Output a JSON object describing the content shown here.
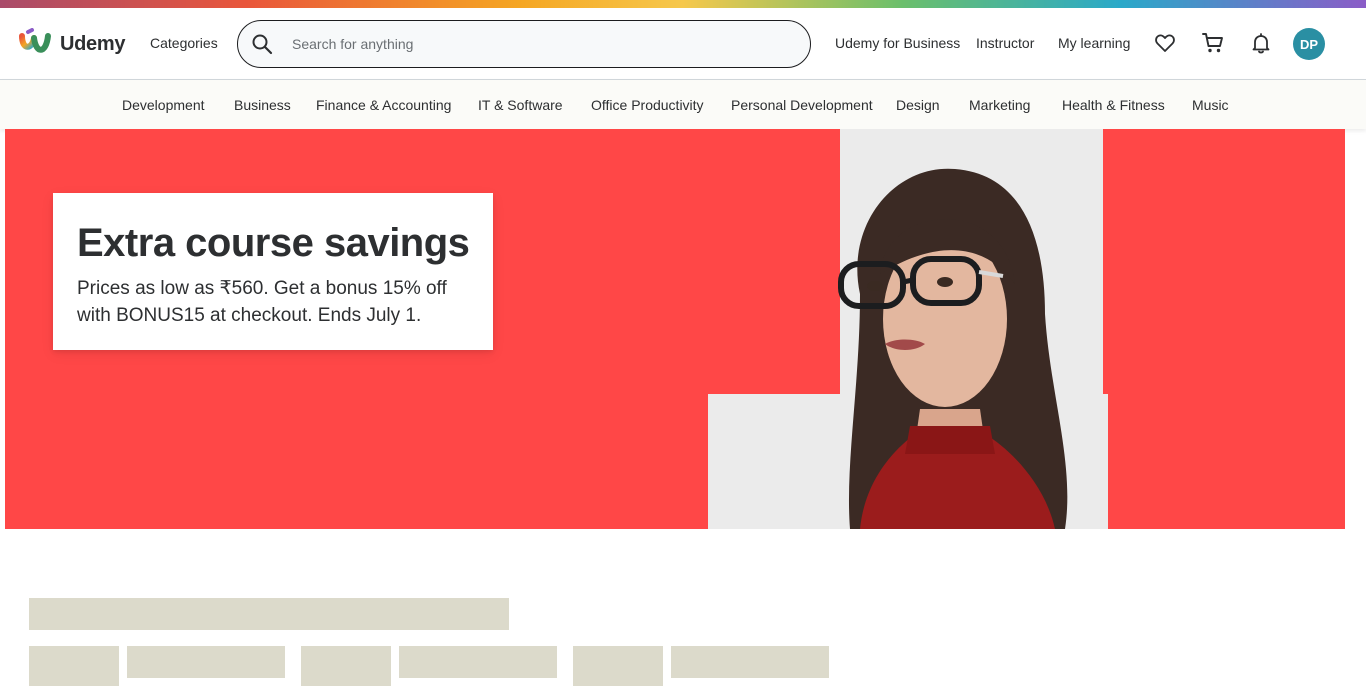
{
  "brand": {
    "name": "Udemy"
  },
  "header": {
    "categories_label": "Categories",
    "search_placeholder": "Search for anything",
    "business_label": "Udemy for Business",
    "instructor_label": "Instructor",
    "my_learning_label": "My learning",
    "icons": [
      "search-icon",
      "heart-icon",
      "cart-icon",
      "bell-icon"
    ],
    "avatar_initials": "DP"
  },
  "categories": [
    "Development",
    "Business",
    "Finance & Accounting",
    "IT & Software",
    "Office Productivity",
    "Personal Development",
    "Design",
    "Marketing",
    "Health & Fitness",
    "Music"
  ],
  "hero": {
    "title": "Extra course savings",
    "subtitle": "Prices as low as ₹560. Get a bonus 15% off with BONUS15 at checkout. Ends July 1."
  },
  "colors": {
    "hero_bg": "#ff4747",
    "avatar_bg": "#2a8fa3",
    "skeleton": "#dcdacb"
  }
}
